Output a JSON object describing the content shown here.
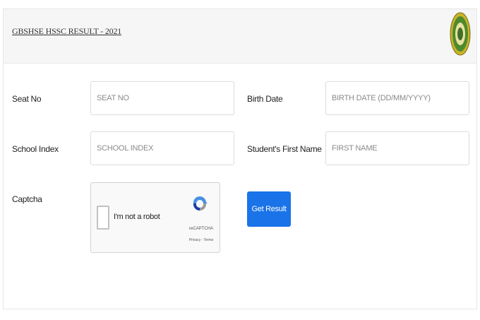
{
  "header": {
    "title": "GBSHSE HSSC RESULT - 2021"
  },
  "form": {
    "seat_no": {
      "label": "Seat No",
      "placeholder": "SEAT NO",
      "value": ""
    },
    "birth_date": {
      "label": "Birth Date",
      "placeholder": "BIRTH DATE (DD/MM/YYYY)",
      "value": ""
    },
    "school_index": {
      "label": "School Index",
      "placeholder": "SCHOOL INDEX",
      "value": ""
    },
    "first_name": {
      "label": "Student's First Name",
      "placeholder": "FIRST NAME",
      "value": ""
    },
    "captcha": {
      "label": "Captcha",
      "checkbox_text": "I'm not a robot",
      "brand": "reCAPTCHA",
      "links": "Privacy - Terms"
    },
    "submit_label": "Get Result"
  },
  "colors": {
    "button": "#1a73e8",
    "header_bg": "#f6f6f6",
    "emblem": "#c9b52a"
  },
  "icons": {
    "emblem": "board-emblem-icon",
    "recaptcha": "recaptcha-logo-icon"
  }
}
